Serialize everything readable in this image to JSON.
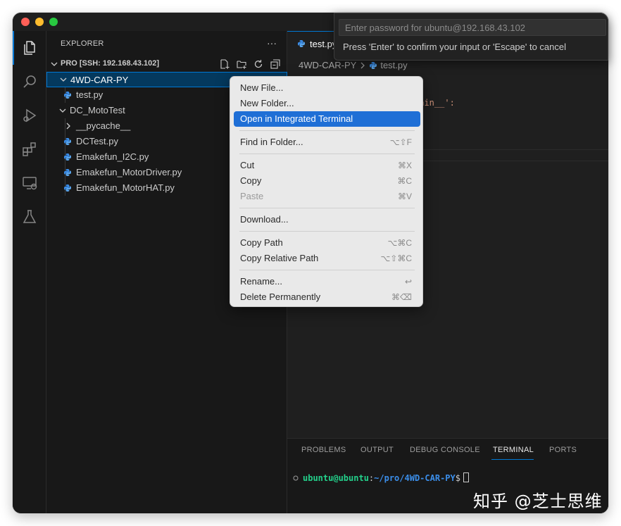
{
  "window": {
    "traffic_lights": [
      "close",
      "minimize",
      "maximize"
    ]
  },
  "activity_bar": {
    "items": [
      "explorer-icon",
      "search-icon",
      "run-debug-icon",
      "extensions-icon",
      "remote-explorer-icon",
      "testing-icon"
    ],
    "active": "explorer-icon",
    "accent_color": "#0078d4"
  },
  "explorer": {
    "title": "EXPLORER",
    "more": "···",
    "section_label": "PRO [SSH: 192.168.43.102]",
    "section_actions": [
      "new-file-icon",
      "new-folder-icon",
      "refresh-icon",
      "collapse-all-icon"
    ],
    "tree": [
      {
        "label": "4WD-CAR-PY",
        "type": "folder-open",
        "selected": true
      },
      {
        "label": "test.py",
        "type": "py"
      },
      {
        "label": "DC_MotoTest",
        "type": "folder-open"
      },
      {
        "label": "__pycache__",
        "type": "folder-closed"
      },
      {
        "label": "DCTest.py",
        "type": "py"
      },
      {
        "label": "Emakefun_I2C.py",
        "type": "py"
      },
      {
        "label": "Emakefun_MotorDriver.py",
        "type": "py"
      },
      {
        "label": "Emakefun_MotorHAT.py",
        "type": "py"
      }
    ]
  },
  "editor": {
    "tab_label": "test.py",
    "breadcrumb": [
      "4WD-CAR-PY",
      "test.py"
    ],
    "code_fragment": "main__':"
  },
  "quick_input": {
    "placeholder": "Enter password for ubuntu@192.168.43.102",
    "message": "Press 'Enter' to confirm your input or 'Escape' to cancel"
  },
  "context_menu": {
    "groups": [
      [
        {
          "label": "New File...",
          "shortcut": ""
        },
        {
          "label": "New Folder...",
          "shortcut": ""
        },
        {
          "label": "Open in Integrated Terminal",
          "shortcut": "",
          "highlighted": true
        }
      ],
      [
        {
          "label": "Find in Folder...",
          "shortcut": "⌥⇧F"
        }
      ],
      [
        {
          "label": "Cut",
          "shortcut": "⌘X"
        },
        {
          "label": "Copy",
          "shortcut": "⌘C"
        },
        {
          "label": "Paste",
          "shortcut": "⌘V",
          "disabled": true
        }
      ],
      [
        {
          "label": "Download...",
          "shortcut": ""
        }
      ],
      [
        {
          "label": "Copy Path",
          "shortcut": "⌥⌘C"
        },
        {
          "label": "Copy Relative Path",
          "shortcut": "⌥⇧⌘C"
        }
      ],
      [
        {
          "label": "Rename...",
          "shortcut": "↩"
        },
        {
          "label": "Delete Permanently",
          "shortcut": "⌘⌫"
        }
      ]
    ],
    "highlight_color": "#1f6fd6"
  },
  "panel": {
    "tabs": [
      "PROBLEMS",
      "OUTPUT",
      "DEBUG CONSOLE",
      "TERMINAL",
      "PORTS"
    ],
    "active_tab": "TERMINAL",
    "terminal": {
      "user_host": "ubuntu@ubuntu",
      "separator": ":",
      "path": "~/pro/4WD-CAR-PY",
      "prompt": "$"
    }
  },
  "watermark": "知乎 @芝士思维"
}
